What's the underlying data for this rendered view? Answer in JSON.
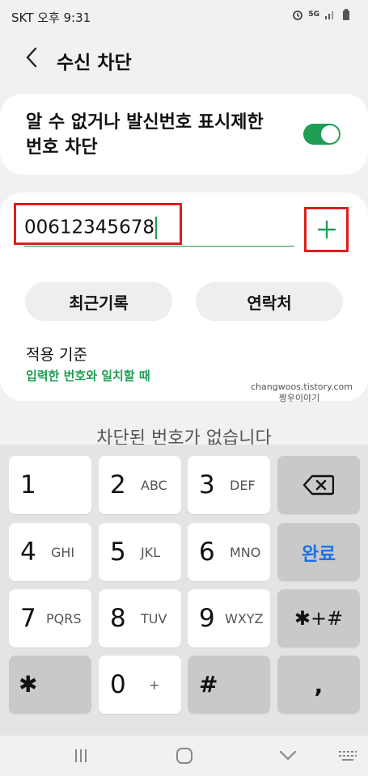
{
  "status_bar": {
    "carrier": "SKT",
    "time": "오후 9:31",
    "network": "5G"
  },
  "header": {
    "title": "수신 차단"
  },
  "unknown_block": {
    "label": "알 수 없거나 발신번호 표시제한 번호 차단",
    "enabled": true
  },
  "number_entry": {
    "value": "00612345678"
  },
  "buttons": {
    "recent": "최근기록",
    "contacts": "연락처"
  },
  "apply_rule": {
    "label": "적용 기준",
    "value": "입력한 번호와 일치할 때"
  },
  "watermark": {
    "line1": "changwoos.tistory.com",
    "line2": "짱우이야기"
  },
  "empty_message": "차단된 번호가 없습니다",
  "keypad": {
    "k1": {
      "digit": "1",
      "letters": ""
    },
    "k2": {
      "digit": "2",
      "letters": "ABC"
    },
    "k3": {
      "digit": "3",
      "letters": "DEF"
    },
    "k4": {
      "digit": "4",
      "letters": "GHI"
    },
    "k5": {
      "digit": "5",
      "letters": "JKL"
    },
    "k6": {
      "digit": "6",
      "letters": "MNO"
    },
    "k7": {
      "digit": "7",
      "letters": "PQRS"
    },
    "k8": {
      "digit": "8",
      "letters": "TUV"
    },
    "k9": {
      "digit": "9",
      "letters": "WXYZ"
    },
    "k0": {
      "digit": "0",
      "letters": "+"
    },
    "star": "✱",
    "hash": "#",
    "done": "완료",
    "symbols": "✱+#",
    "comma": ","
  },
  "colors": {
    "accent": "#1f9d55",
    "highlight": "#e01d1d",
    "done_text": "#1a73e8"
  }
}
